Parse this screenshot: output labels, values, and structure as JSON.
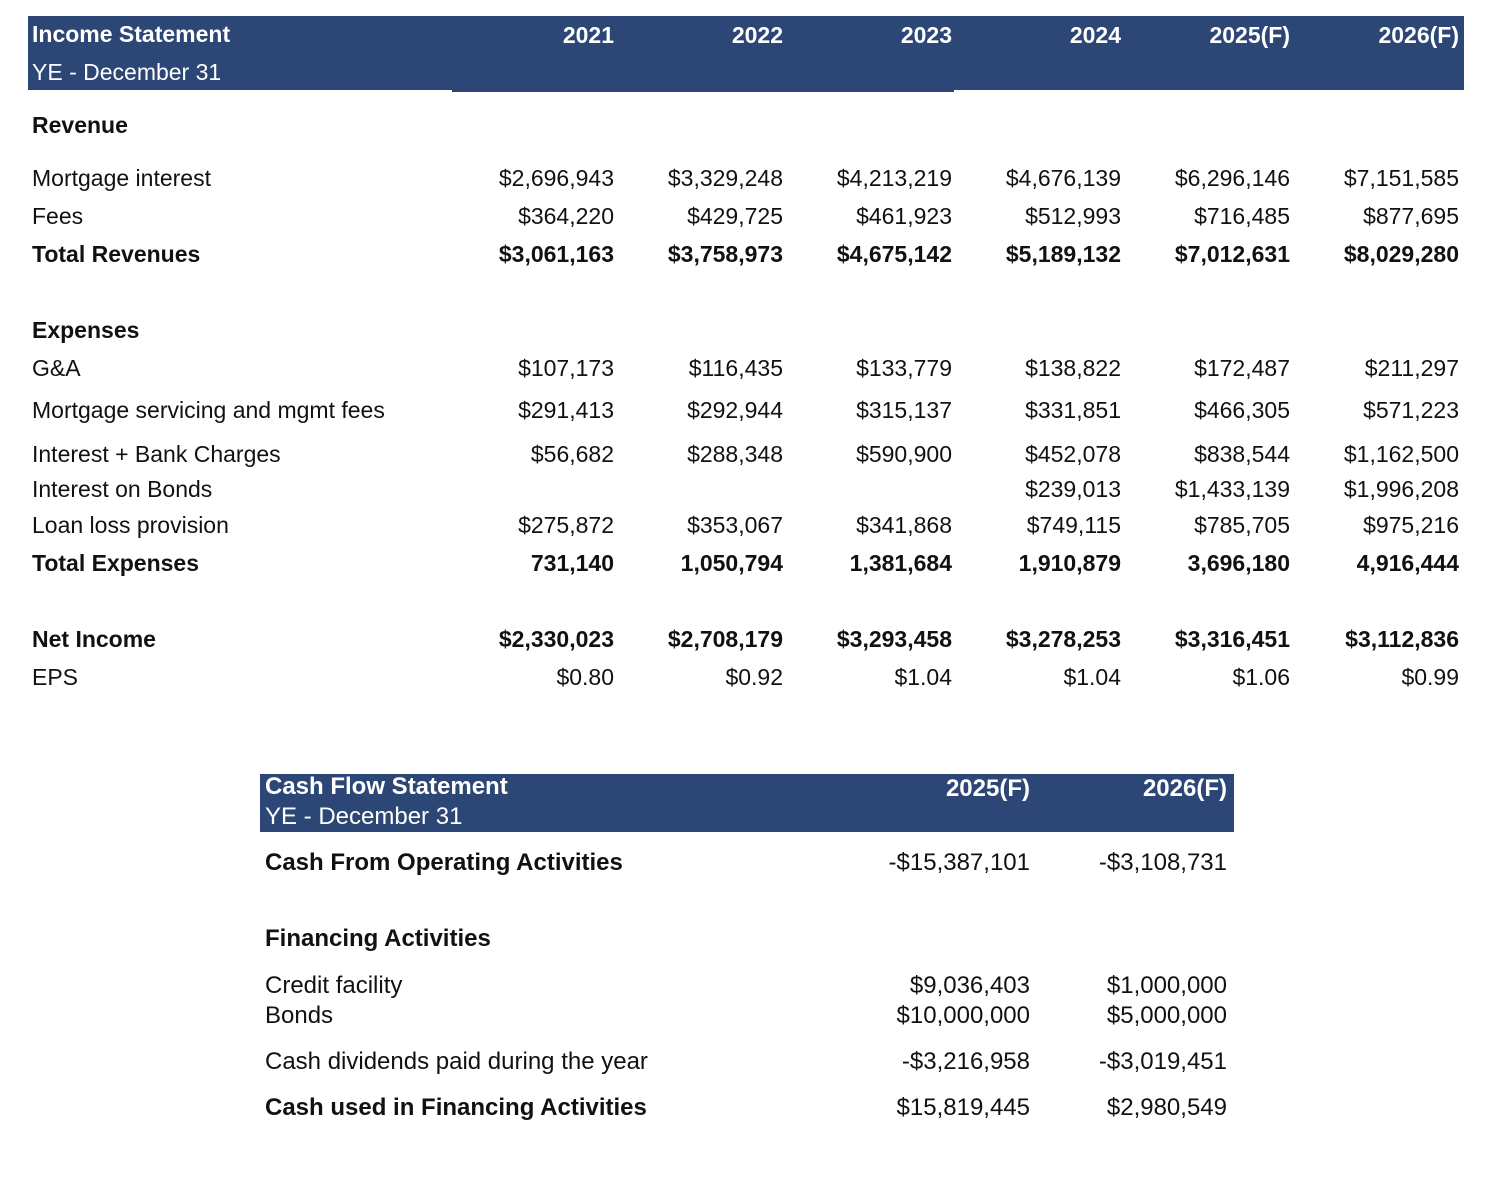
{
  "income_statement": {
    "title": "Income Statement",
    "subtitle": "YE - December 31",
    "years": [
      "2021",
      "2022",
      "2023",
      "2024",
      "2025(F)",
      "2026(F)"
    ],
    "revenue_heading": "Revenue",
    "mortgage_interest": {
      "label": "Mortgage interest",
      "values": [
        "$2,696,943",
        "$3,329,248",
        "$4,213,219",
        "$4,676,139",
        "$6,296,146",
        "$7,151,585"
      ]
    },
    "fees": {
      "label": "Fees",
      "values": [
        "$364,220",
        "$429,725",
        "$461,923",
        "$512,993",
        "$716,485",
        "$877,695"
      ]
    },
    "total_revenues": {
      "label": "Total Revenues",
      "values": [
        "$3,061,163",
        "$3,758,973",
        "$4,675,142",
        "$5,189,132",
        "$7,012,631",
        "$8,029,280"
      ]
    },
    "expenses_heading": "Expenses",
    "ga": {
      "label": "G&A",
      "values": [
        "$107,173",
        "$116,435",
        "$133,779",
        "$138,822",
        "$172,487",
        "$211,297"
      ]
    },
    "mortgage_servicing": {
      "label": "Mortgage servicing and mgmt fees",
      "values": [
        "$291,413",
        "$292,944",
        "$315,137",
        "$331,851",
        "$466,305",
        "$571,223"
      ]
    },
    "interest_bank": {
      "label": "Interest + Bank Charges",
      "values": [
        "$56,682",
        "$288,348",
        "$590,900",
        "$452,078",
        "$838,544",
        "$1,162,500"
      ]
    },
    "interest_bonds": {
      "label": "Interest on Bonds",
      "values": [
        "",
        "",
        "",
        "$239,013",
        "$1,433,139",
        "$1,996,208"
      ]
    },
    "loan_loss": {
      "label": "Loan loss provision",
      "values": [
        "$275,872",
        "$353,067",
        "$341,868",
        "$749,115",
        "$785,705",
        "$975,216"
      ]
    },
    "total_expenses": {
      "label": "Total Expenses",
      "values": [
        "731,140",
        "1,050,794",
        "1,381,684",
        "1,910,879",
        "3,696,180",
        "4,916,444"
      ]
    },
    "net_income": {
      "label": "Net Income",
      "values": [
        "$2,330,023",
        "$2,708,179",
        "$3,293,458",
        "$3,278,253",
        "$3,316,451",
        "$3,112,836"
      ]
    },
    "eps": {
      "label": "EPS",
      "values": [
        "$0.80",
        "$0.92",
        "$1.04",
        "$1.04",
        "$1.06",
        "$0.99"
      ]
    }
  },
  "cash_flow": {
    "title": "Cash Flow Statement",
    "subtitle": "YE - December 31",
    "years": [
      "2025(F)",
      "2026(F)"
    ],
    "operating": {
      "label": "Cash From Operating Activities",
      "values": [
        "-$15,387,101",
        "-$3,108,731"
      ]
    },
    "financing_heading": "Financing Activities",
    "credit_facility": {
      "label": "Credit facility",
      "values": [
        "$9,036,403",
        "$1,000,000"
      ]
    },
    "bonds": {
      "label": "Bonds",
      "values": [
        "$10,000,000",
        "$5,000,000"
      ]
    },
    "dividends": {
      "label": "Cash dividends paid during the year",
      "values": [
        "-$3,216,958",
        "-$3,019,451"
      ]
    },
    "financing_total": {
      "label": "Cash used in Financing Activities",
      "values": [
        "$15,819,445",
        "$2,980,549"
      ]
    }
  }
}
